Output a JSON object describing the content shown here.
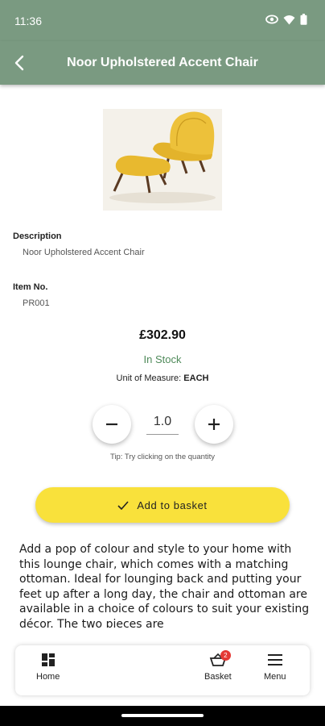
{
  "status_bar": {
    "time": "11:36",
    "icons": [
      "eye-icon",
      "wifi-icon",
      "battery-icon"
    ]
  },
  "app_bar": {
    "back_icon": "back-arrow-icon",
    "title": "Noor Upholstered Accent Chair"
  },
  "product": {
    "image": "yellow-chair-with-ottoman",
    "description_label": "Description",
    "description_value": "Noor Upholstered Accent Chair",
    "item_no_label": "Item No.",
    "item_no_value": "PR001",
    "price": "£302.90",
    "stock_status": "In Stock",
    "uom_label": "Unit of Measure: ",
    "uom_value": "EACH"
  },
  "quantity": {
    "value": "1.0",
    "tip": "Tip: Try clicking on the quantity",
    "decrement_icon": "minus-icon",
    "increment_icon": "plus-icon"
  },
  "add_to_basket": {
    "label": "Add to basket",
    "icon": "check-icon"
  },
  "long_description": "Add a pop of colour and style to your home with this lounge chair, which comes with a matching ottoman. Ideal for lounging back and putting your feet up after a long day, the chair and ottoman are available in a choice of colours to suit your existing décor. The two pieces are",
  "bottom_nav": {
    "home": "Home",
    "basket": "Basket",
    "basket_count": "2",
    "menu": "Menu"
  },
  "colors": {
    "header": "#7a9a81",
    "accent_button": "#f9e13b",
    "in_stock": "#4f8a5a",
    "badge": "#e53935"
  }
}
